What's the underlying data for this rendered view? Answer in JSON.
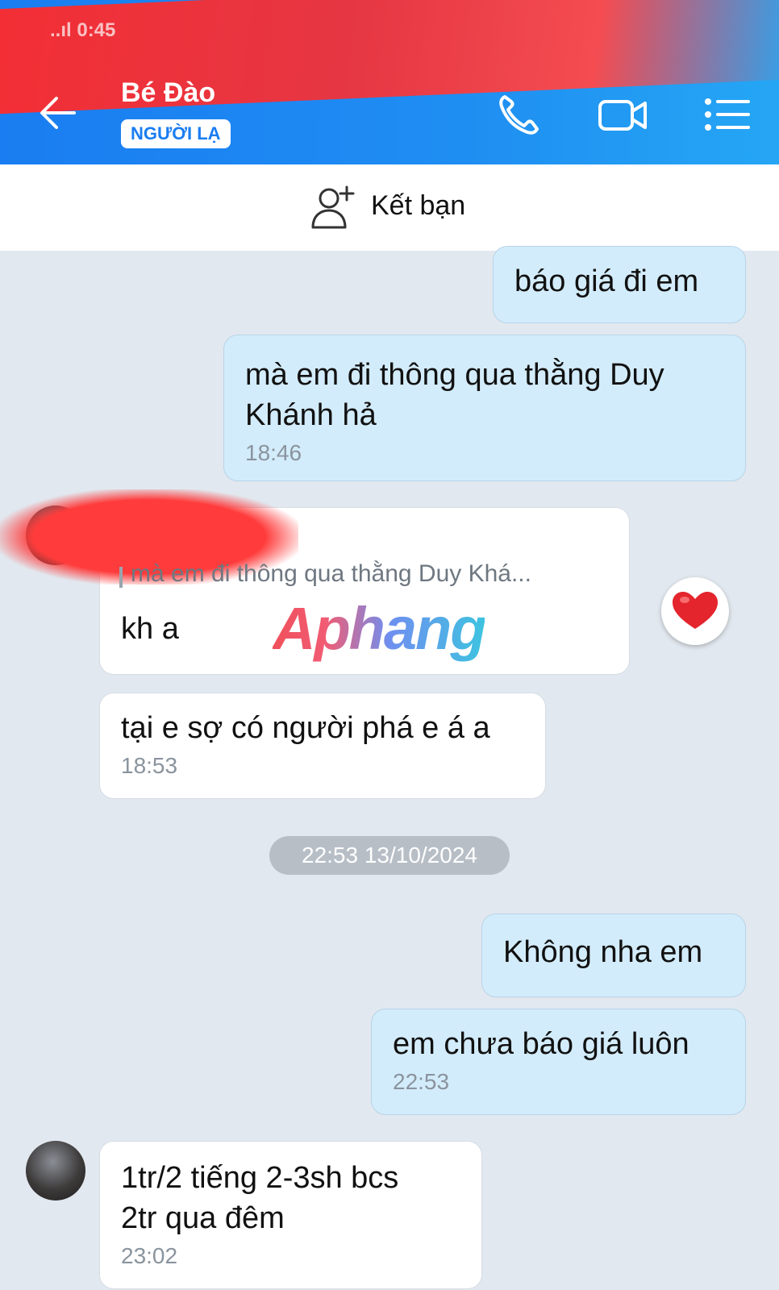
{
  "status_bar": {
    "signal_text": "..ıl 0:45"
  },
  "header": {
    "title": "Bé Đào",
    "badge": "NGƯỜI LẠ",
    "back_icon": "arrow-left-icon",
    "call_icon": "phone-icon",
    "video_icon": "video-camera-icon",
    "menu_icon": "list-menu-icon",
    "colors": {
      "header_bg": "#1f8ef2",
      "scribble": "#f0323a"
    }
  },
  "add_friend": {
    "label": "Kết bạn",
    "icon": "add-user-icon"
  },
  "messages": [
    {
      "side": "sent",
      "text": "báo giá đi em",
      "time": ""
    },
    {
      "side": "sent",
      "text": "mà em đi thông qua thằng Duy Khánh hả",
      "time": "18:46"
    },
    {
      "side": "received",
      "quote": "mà em đi thông qua thằng Duy Khá...",
      "text": "kh a",
      "reaction": "heart-icon"
    },
    {
      "side": "received",
      "text": "tại e sợ có người phá e á a",
      "time": "18:53"
    },
    {
      "side": "sent",
      "text": "Không nha em",
      "time": ""
    },
    {
      "side": "sent",
      "text": "em chưa báo giá luôn",
      "time": "22:53"
    },
    {
      "side": "received",
      "text": "1tr/2 tiếng 2-3sh bcs 2tr qua đêm",
      "time": "23:02"
    }
  ],
  "date_separator": "22:53 13/10/2024",
  "watermark": "Aphang",
  "colors": {
    "sent_bubble": "#d3ecfb",
    "received_bubble": "#ffffff",
    "chat_bg": "#e2e8ef",
    "accent": "#1a7df1"
  }
}
